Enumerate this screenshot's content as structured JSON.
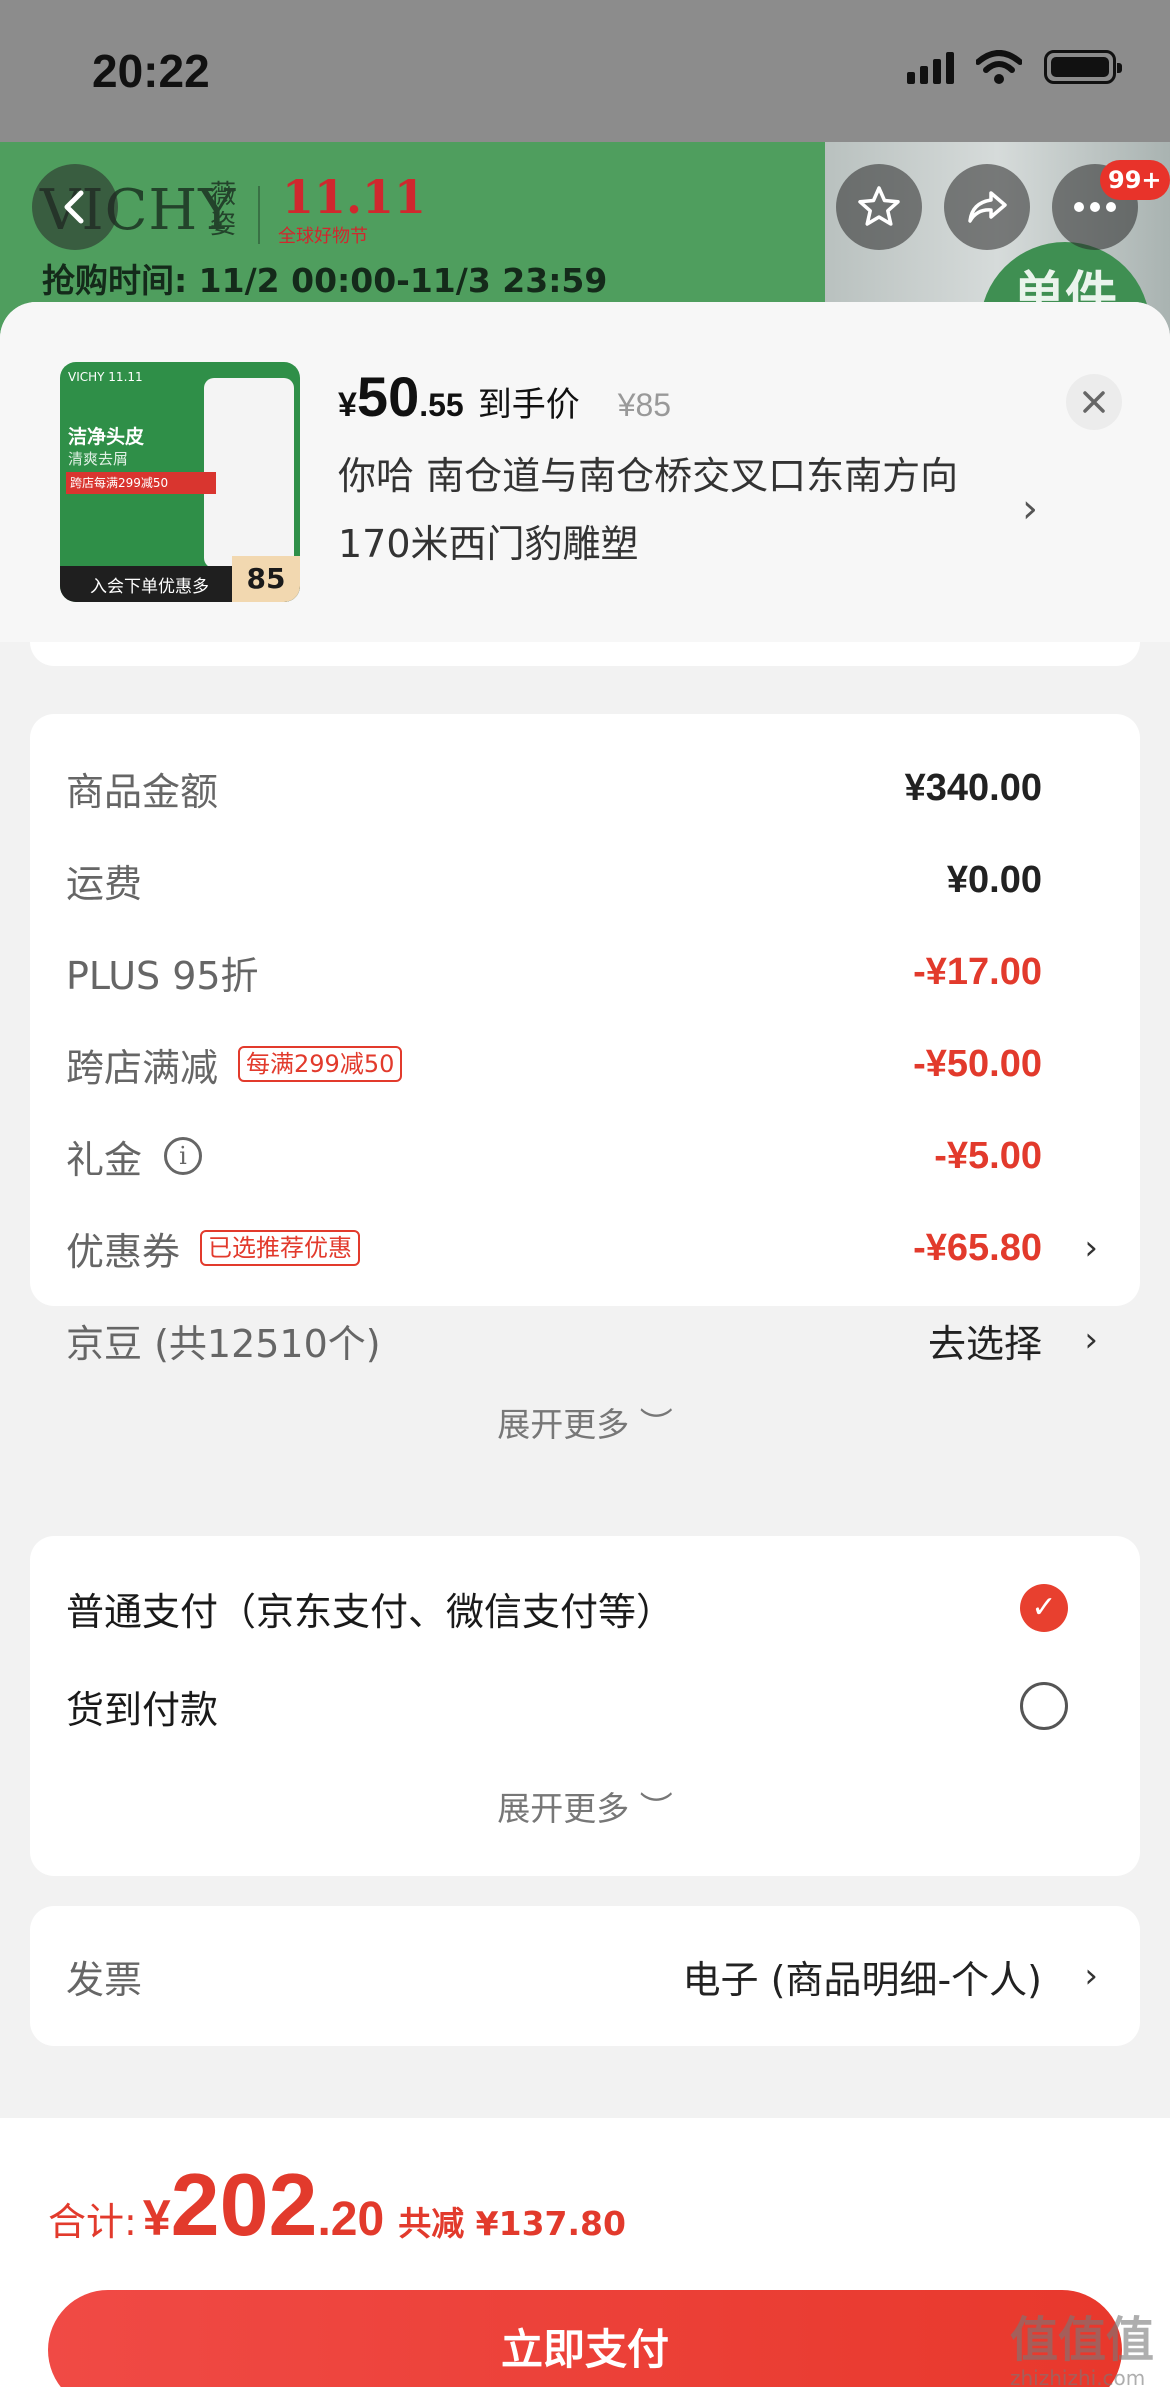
{
  "status_bar": {
    "time": "20:22"
  },
  "banner": {
    "brand": "VICHY",
    "brand_cn": "薇姿",
    "event": "11.11",
    "event_sub": "全球好物节",
    "sale_time": "抢购时间: 11/2 00:00-11/3 23:59",
    "badge": "单件",
    "more_count": "99+"
  },
  "product": {
    "thumb": {
      "title": "洁净头皮",
      "subtitle": "清爽去屑",
      "promo": "跨店每满299减50",
      "footer": "入会下单优惠多",
      "price": "85",
      "logo": "VICHY 11.11"
    },
    "price_yen": "¥",
    "price_int": "50",
    "price_dec": ".55",
    "price_label": "到手价",
    "original_price": "¥85",
    "address": "你哈  南仓道与南仓桥交叉口东南方向170米西门豹雕塑"
  },
  "summary": {
    "rows": [
      {
        "label": "商品金额",
        "value": "¥340.00"
      },
      {
        "label": "运费",
        "value": "¥0.00"
      },
      {
        "label": "PLUS 95折",
        "value": "-¥17.00"
      },
      {
        "label": "跨店满减",
        "tag": "每满299减50",
        "value": "-¥50.00"
      },
      {
        "label": "礼金",
        "value": "-¥5.00"
      },
      {
        "label": "优惠券",
        "tag": "已选推荐优惠",
        "value": "-¥65.80"
      },
      {
        "label": "京豆 (共12510个)",
        "value": "去选择"
      }
    ],
    "expand": "展开更多 ︶"
  },
  "payment": {
    "options": [
      {
        "label": "普通支付（京东支付、微信支付等）",
        "selected": true
      },
      {
        "label": "货到付款",
        "selected": false
      }
    ],
    "expand": "展开更多 ︶"
  },
  "invoice": {
    "label": "发票",
    "value": "电子 (商品明细-个人)"
  },
  "footer": {
    "total_label": "合计:",
    "total_yen": "¥",
    "total_int": "202",
    "total_dec": ".20",
    "total_save": "共减 ¥137.80",
    "pay_button": "立即支付"
  },
  "watermark": {
    "main": "值值值",
    "sub": "zhizhizhi.com"
  },
  "colors": {
    "accent": "#e23a2c",
    "banner_green": "#4f9e5e"
  }
}
